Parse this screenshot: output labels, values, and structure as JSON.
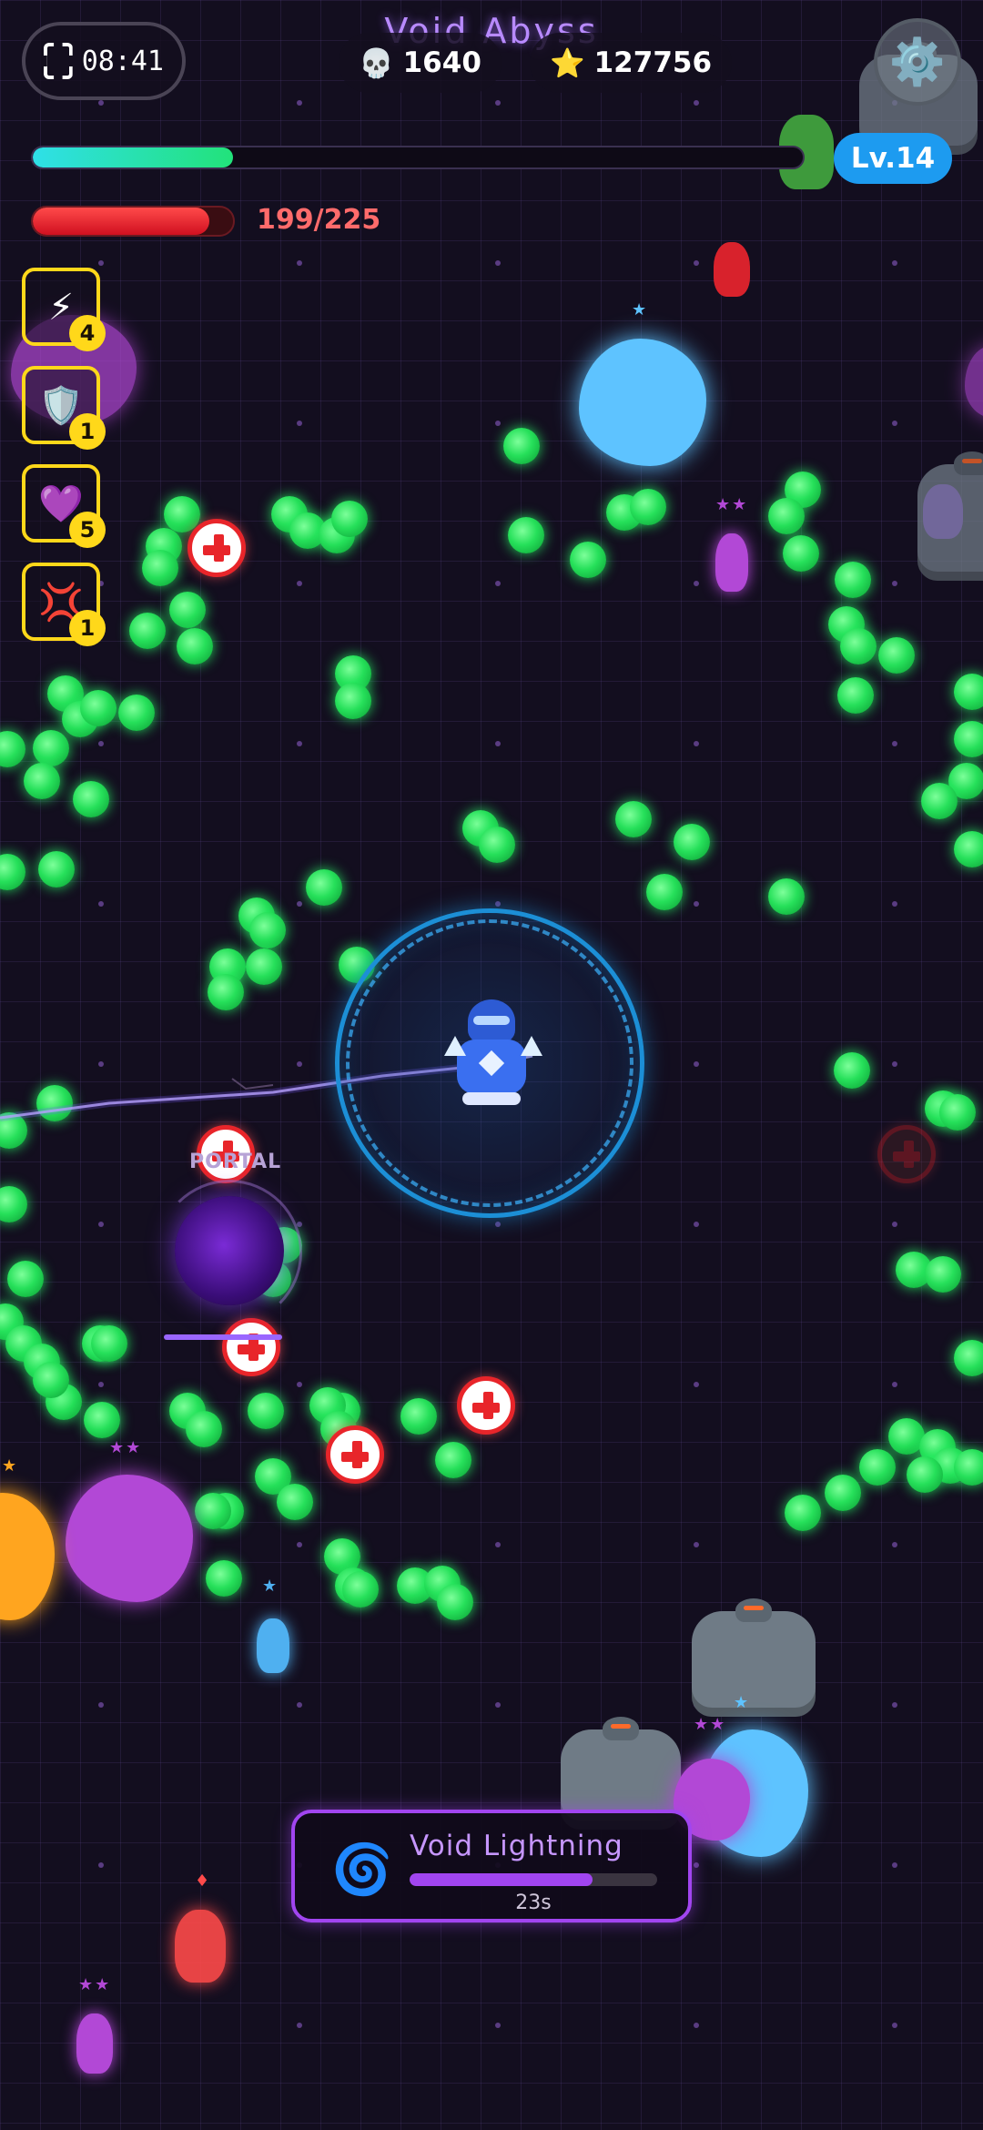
{
  "hud": {
    "timer": "08:41",
    "stage_title": "Void Abyss",
    "kills": "1640",
    "coins": "127756",
    "level": "Lv.14",
    "xp_progress": 0.26,
    "hp_text": "199/225",
    "hp_progress": 0.884
  },
  "skills": [
    {
      "icon": "lightning-icon",
      "glyph": "⚡",
      "count": "4"
    },
    {
      "icon": "shield-icon",
      "glyph": "🛡️",
      "count": "1"
    },
    {
      "icon": "heart-icon",
      "glyph": "💜",
      "count": "5"
    },
    {
      "icon": "anger-icon",
      "glyph": "💢",
      "count": "1"
    }
  ],
  "portal_label": "PORTAL",
  "ability": {
    "name": "Void Lightning",
    "cooldown": "23s",
    "progress": 0.74,
    "icon": "spiral-icon"
  },
  "enemy_stars": {
    "small_purple": "★★",
    "big_purple": "★★",
    "blue_big": "★",
    "blue_small": "★",
    "orange": "★",
    "blue_bottom": "★",
    "purple_bottom": "★★",
    "mini_bottom": "★★",
    "red_marker": "♦"
  },
  "colors": {
    "accent": "#a145f0",
    "xp": "#22e27a",
    "hp": "#e0202f",
    "level_badge": "#1d9bf0",
    "skill_border": "#ffd81a",
    "orb": "#26e05a"
  }
}
